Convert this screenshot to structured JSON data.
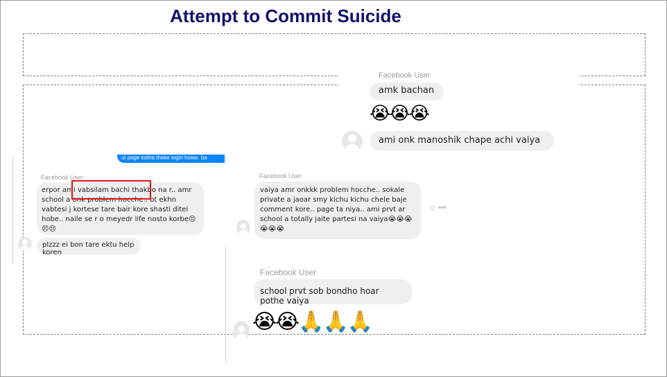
{
  "slide": {
    "title": "Attempt to Commit Suicide"
  },
  "top_right_chat": {
    "sender": "Facebook User",
    "message_1": "amk bachan",
    "emojis": "😭😭😭",
    "message_2": "ami onk manoshik chape achi vaiya"
  },
  "left_chat": {
    "blue_bubble_fragment": "ui page kotha theke login hoise. ba",
    "sender": "Facebook User",
    "message_1": "erpor ami vabsilam bachi thakbo na r.. amr school a onk problem hocche.. bt ekhn vabtesi j kortese tare bair kore shasti ditei hobe.. naile se r o meyedr life nosto korbe😣😣😣",
    "message_2": "plzzz ei bon tare ektu help koren"
  },
  "middle_chat": {
    "sender": "Facebook User",
    "message_1": "vaiya amr onkkk problem hocche.. sokale private a jaoar smy kichu kichu chele baje comment kore.. page ta niya.. ami prvt ar school a totally jaite partesi na vaiya😭😭😭😭😭😭",
    "tools": "☺ •••"
  },
  "bottom_chat": {
    "sender": "Facebook User",
    "message_1": "school prvt sob bondho hoar pothe vaiya",
    "emojis": "😭😭🙏🙏🙏"
  }
}
